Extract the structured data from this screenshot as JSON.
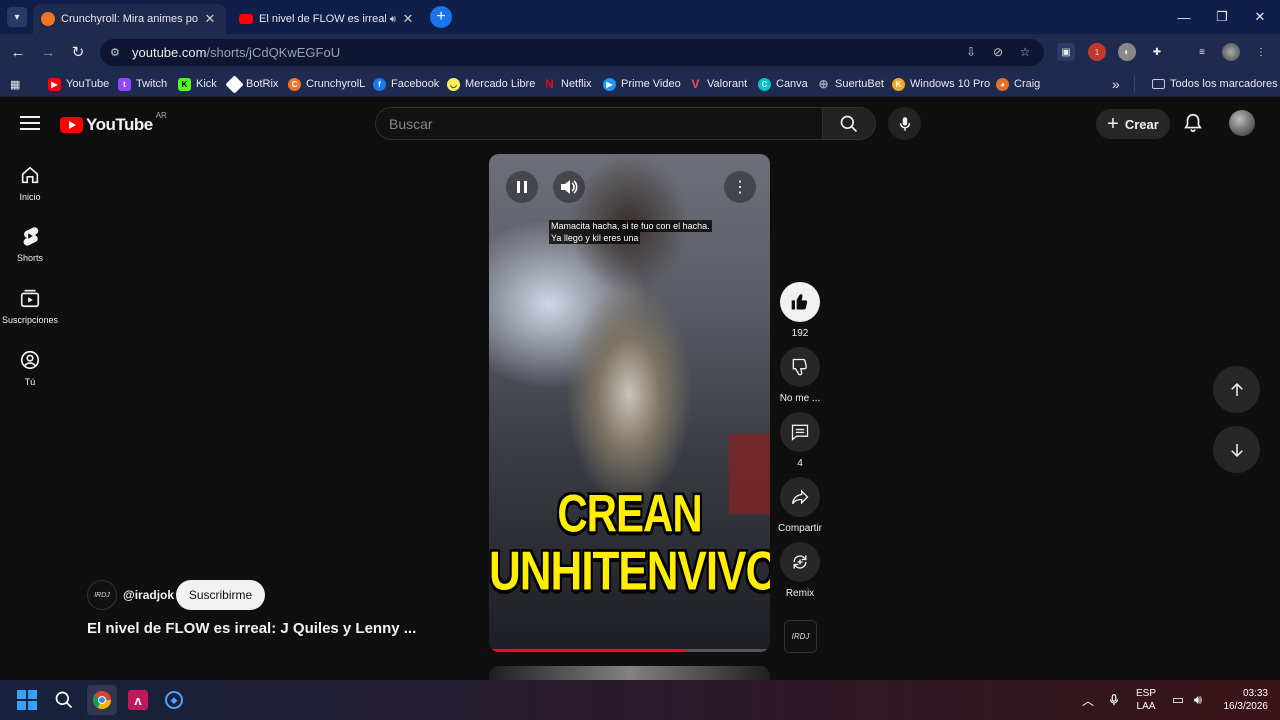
{
  "browser": {
    "tabs": [
      {
        "title": "Crunchyroll: Mira animes popul",
        "active": true
      },
      {
        "title": "El nivel de FLOW es irreal: J",
        "active": false
      }
    ],
    "address": {
      "host": "youtube.com",
      "path": "/shorts/jCdQKwEGFoU"
    },
    "extension_badge": "1",
    "bookmarks": [
      {
        "label": "YouTube",
        "icon": "youtube-icon",
        "color": "#ff0000"
      },
      {
        "label": "Twitch",
        "icon": "twitch-icon",
        "color": "#9146ff"
      },
      {
        "label": "Kick",
        "icon": "kick-icon",
        "color": "#53fc18"
      },
      {
        "label": "BotRix",
        "icon": "botrix-icon",
        "color": "#ffffff"
      },
      {
        "label": "CrunchyrolL",
        "icon": "crunchyroll-icon",
        "color": "#f47521"
      },
      {
        "label": "Facebook",
        "icon": "facebook-icon",
        "color": "#1877f2"
      },
      {
        "label": "Mercado Libre",
        "icon": "mercadolibre-icon",
        "color": "#fff159"
      },
      {
        "label": "Netflix",
        "icon": "netflix-icon",
        "color": "#e50914"
      },
      {
        "label": "Prime Video",
        "icon": "primevideo-icon",
        "color": "#1a98ff"
      },
      {
        "label": "Valorant",
        "icon": "valorant-icon",
        "color": "#ff4655"
      },
      {
        "label": "Canva",
        "icon": "canva-icon",
        "color": "#00c4cc"
      },
      {
        "label": "SuertuBet",
        "icon": "globe-icon",
        "color": "#9aa0ae"
      },
      {
        "label": "Windows 10 Pro",
        "icon": "windows-key-icon",
        "color": "#f5a623"
      },
      {
        "label": "Craig",
        "icon": "craig-icon",
        "color": "#e0712c"
      }
    ],
    "all_bookmarks": "Todos los marcadores"
  },
  "youtube": {
    "logo_text": "YouTube",
    "country_code": "AR",
    "search_placeholder": "Buscar",
    "create_label": "Crear",
    "sidebar": [
      {
        "label": "Inicio",
        "icon": "home-icon"
      },
      {
        "label": "Shorts",
        "icon": "shorts-icon"
      },
      {
        "label": "Suscripciones",
        "icon": "subscriptions-icon"
      },
      {
        "label": "Tú",
        "icon": "you-icon"
      }
    ],
    "short": {
      "caption_line1": "Mamacita hacha, si te fuo con el hacha.",
      "caption_line2": "Ya llegó y kil eres una",
      "overlay_line1": "CREAN",
      "overlay_line2": "UNHITENVIVO",
      "progress": 0.7,
      "likes": "192",
      "dislike_label": "No me ...",
      "comments": "4",
      "share_label": "Compartir",
      "remix_label": "Remix",
      "channel_handle": "@iradjok",
      "channel_logo_text": "IRDJ",
      "subscribe_label": "Suscribirme",
      "title": "El nivel de FLOW es irreal: J Quiles y Lenny ..."
    }
  },
  "taskbar": {
    "language": "ESP",
    "layout": "LAA",
    "time": "03:33",
    "date": "16/3/2026"
  }
}
